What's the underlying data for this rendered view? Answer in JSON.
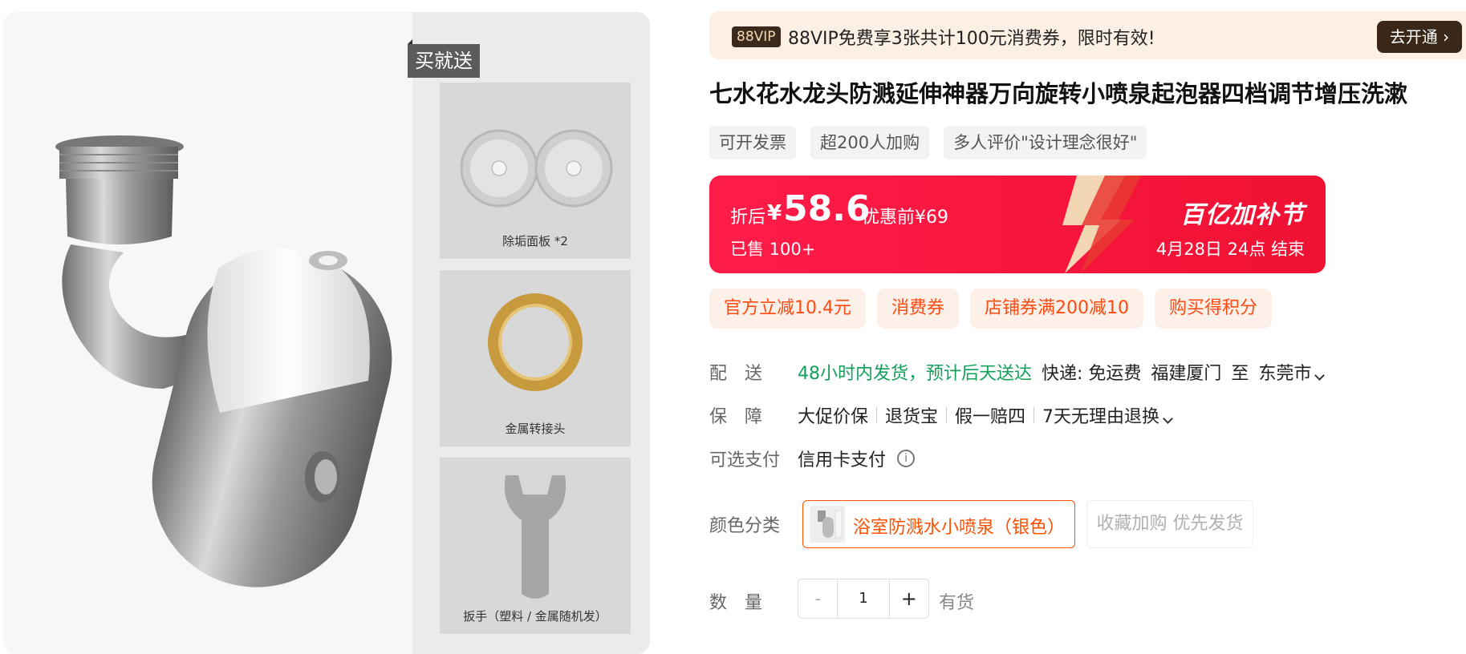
{
  "gallery": {
    "gift_tag": "买就送",
    "accessories": [
      {
        "label": "除垢面板 *2"
      },
      {
        "label": "金属转接头"
      },
      {
        "label": "扳手（塑料 / 金属随机发）"
      }
    ]
  },
  "vip": {
    "badge": "88VIP",
    "text": "88VIP免费享3张共计100元消费券，限时有效!",
    "button": "去开通 ›"
  },
  "product": {
    "title": "七水花水龙头防溅延伸神器万向旋转小喷泉起泡器四档调节增压洗漱",
    "tags": [
      "可开发票",
      "超200人加购",
      "多人评价\"设计理念很好\""
    ]
  },
  "price": {
    "after_label": "折后",
    "currency": "¥",
    "value": "58.6",
    "before": "优惠前¥69",
    "sold": "已售 100+",
    "festival": "百亿加补节",
    "end": "4月28日 24点  结束"
  },
  "coupons": [
    "官方立减10.4元",
    "消费券",
    "店铺券满200减10",
    "购买得积分"
  ],
  "shipping": {
    "label": "配　送",
    "promise": "48小时内发货，预计后天送达",
    "express": "快递: 免运费",
    "from": "福建厦门",
    "to_word": "至",
    "dest": "东莞市"
  },
  "guarantee": {
    "label": "保　障",
    "items": [
      "大促价保",
      "退货宝",
      "假一赔四",
      "7天无理由退换"
    ]
  },
  "payment": {
    "label": "可选支付",
    "value": "信用卡支付",
    "info_icon": "ⓘ"
  },
  "sku": {
    "label": "颜色分类",
    "selected": "浴室防溅水小喷泉（银色）",
    "alternate": "收藏加购 优先发货"
  },
  "quantity": {
    "label": "数　量",
    "minus": "-",
    "value": "1",
    "plus": "+",
    "stock": "有货"
  },
  "colors": {
    "accent": "#ff5000",
    "price_red": "#ff1c49",
    "ship_green": "#12a05b",
    "vip_bg": "#fcefe3"
  }
}
